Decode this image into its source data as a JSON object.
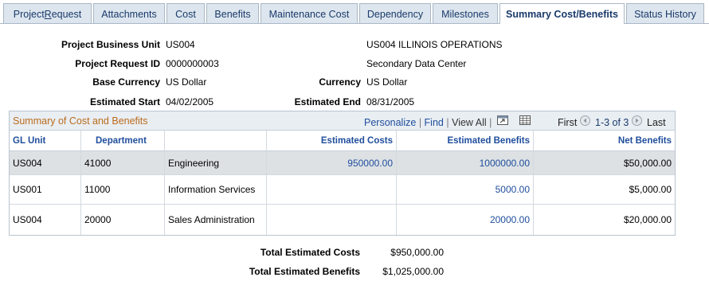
{
  "tabs": [
    {
      "label": "Project Request",
      "pre": "Project ",
      "u": "R",
      "post": "equest"
    },
    {
      "label": "Attachments"
    },
    {
      "label": "Cost"
    },
    {
      "label": "Benefits"
    },
    {
      "label": "Maintenance Cost"
    },
    {
      "label": "Dependency"
    },
    {
      "label": "Milestones"
    },
    {
      "label": "Summary Cost/Benefits",
      "active": true
    },
    {
      "label": "Status History"
    }
  ],
  "header": {
    "business_unit_label": "Project Business Unit",
    "business_unit_value": "US004",
    "business_unit_desc": "US004 ILLINOIS OPERATIONS",
    "request_id_label": "Project Request ID",
    "request_id_value": "0000000003",
    "request_desc": "Secondary Data Center",
    "base_currency_label": "Base Currency",
    "base_currency_value": "US Dollar",
    "currency_label": "Currency",
    "currency_value": "US Dollar",
    "est_start_label": "Estimated Start",
    "est_start_value": "04/02/2005",
    "est_end_label": "Estimated End",
    "est_end_value": "08/31/2005"
  },
  "grid": {
    "title": "Summary of Cost and Benefits",
    "personalize": "Personalize",
    "find": "Find",
    "view_all": "View All",
    "first": "First",
    "range": "1-3 of 3",
    "last": "Last",
    "columns": [
      "GL Unit",
      "Department",
      "",
      "Estimated Costs",
      "Estimated Benefits",
      "Net Benefits"
    ],
    "rows": [
      {
        "gl_unit": "US004",
        "dept": "41000",
        "dept_name": "Engineering",
        "est_costs": "950000.00",
        "est_benefits": "1000000.00",
        "net": "$50,000.00",
        "highlight": true
      },
      {
        "gl_unit": "US001",
        "dept": "11000",
        "dept_name": "Information Services",
        "est_costs": "",
        "est_benefits": "5000.00",
        "net": "$5,000.00"
      },
      {
        "gl_unit": "US004",
        "dept": "20000",
        "dept_name": "Sales Administration",
        "est_costs": "",
        "est_benefits": "20000.00",
        "net": "$20,000.00"
      }
    ]
  },
  "totals": {
    "costs_label": "Total Estimated Costs",
    "costs_value": "$950,000.00",
    "benefits_label": "Total Estimated Benefits",
    "benefits_value": "$1,025,000.00"
  },
  "colors": {
    "tab_bg": "#dde6ee",
    "link": "#1f4e9c",
    "grid_title": "#bb6b1b",
    "highlight_row": "#dde1e4"
  }
}
